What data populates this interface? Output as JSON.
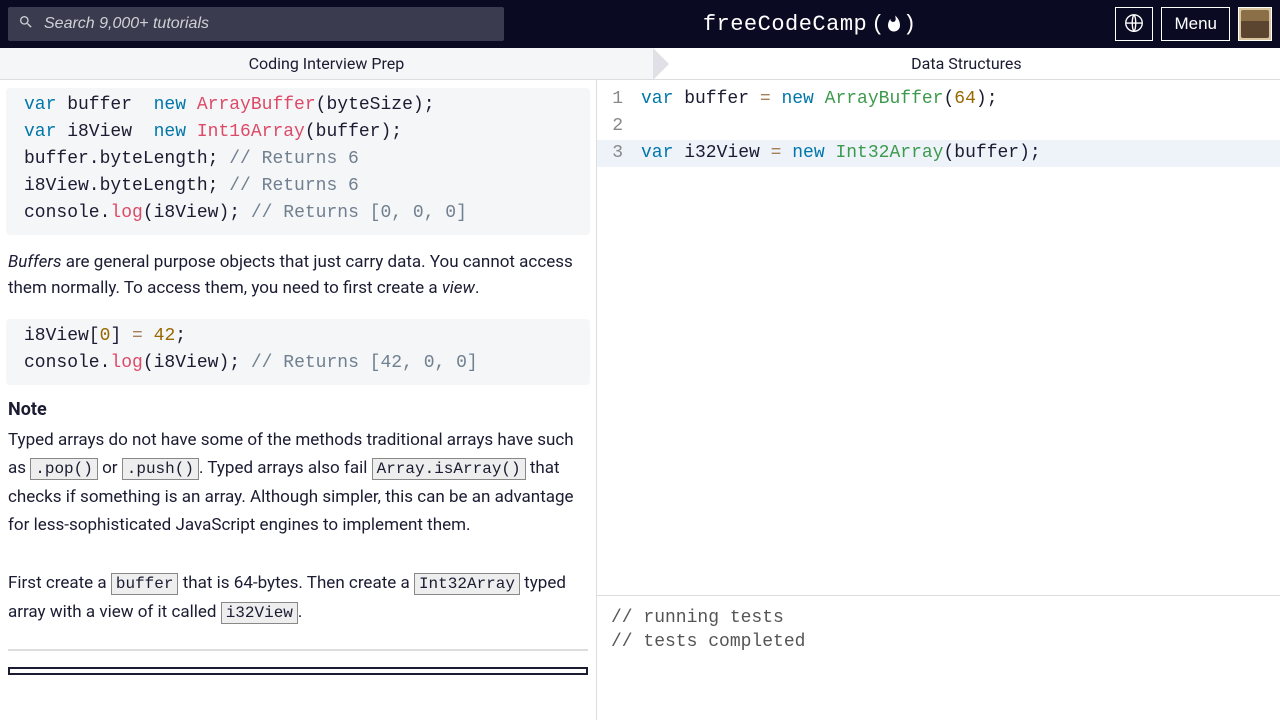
{
  "header": {
    "search_placeholder": "Search 9,000+ tutorials",
    "logo_text": "freeCodeCamp",
    "menu_label": "Menu"
  },
  "breadcrumb": {
    "first": "Coding Interview Prep",
    "second": "Data Structures"
  },
  "lesson": {
    "code1": {
      "l1_kw1": "var",
      "l1_v": " buffer ",
      "l1_op1": "=",
      "l1_kw2": " new ",
      "l1_cls": "ArrayBuffer",
      "l1_rest": "(byteSize);",
      "l2_kw1": "var",
      "l2_v": " i8View ",
      "l2_op1": "=",
      "l2_kw2": " new ",
      "l2_cls": "Int16Array",
      "l2_rest": "(buffer);",
      "l3_a": "buffer.byteLength; ",
      "l3_cmt": "// Returns 6",
      "l4_a": "i8View.byteLength; ",
      "l4_cmt": "// Returns 6",
      "l5_a": "console.",
      "l5_fn": "log",
      "l5_b": "(i8View); ",
      "l5_cmt": "// Returns [0, 0, 0]"
    },
    "para1_pre": "Buffers",
    "para1_mid": " are general purpose objects that just carry data. You cannot access them normally. To access them, you need to first create a ",
    "para1_em": "view",
    "para1_post": ".",
    "code2": {
      "l1_a": "i8View[",
      "l1_n1": "0",
      "l1_b": "] ",
      "l1_op": "=",
      "l1_c": " ",
      "l1_n2": "42",
      "l1_d": ";",
      "l2_a": "console.",
      "l2_fn": "log",
      "l2_b": "(i8View); ",
      "l2_cmt": "// Returns [42, 0, 0]"
    },
    "note_h": "Note",
    "note_p1": "Typed arrays do not have some of the methods traditional arrays have such as ",
    "note_c1": ".pop()",
    "note_p2": " or ",
    "note_c2": ".push()",
    "note_p3": ". Typed arrays also fail ",
    "note_c3": "Array.isArray()",
    "note_p4": " that checks if something is an array. Although simpler, this can be an advantage for less-sophisticated JavaScript engines to implement them.",
    "instr_p1": "First create a ",
    "instr_c1": "buffer",
    "instr_p2": " that is 64-bytes. Then create a ",
    "instr_c2": "Int32Array",
    "instr_p3": " typed array with a view of it called ",
    "instr_c3": "i32View",
    "instr_p4": "."
  },
  "editor": {
    "lines": [
      {
        "n": "1",
        "kw1": "var",
        "v": " buffer ",
        "op": "=",
        "kw2": " new ",
        "cls": "ArrayBuffer",
        "paren1": "(",
        "num": "64",
        "rest": ");"
      },
      {
        "n": "2",
        "kw1": "",
        "v": "",
        "op": "",
        "kw2": "",
        "cls": "",
        "paren1": "",
        "num": "",
        "rest": ""
      },
      {
        "n": "3",
        "kw1": "var",
        "v": " i32View ",
        "op": "=",
        "kw2": " new ",
        "cls": "Int32Array",
        "paren1": "(buffer",
        "num": "",
        "rest": ");"
      }
    ]
  },
  "console": {
    "l1": "// running tests",
    "l2": "// tests completed"
  }
}
